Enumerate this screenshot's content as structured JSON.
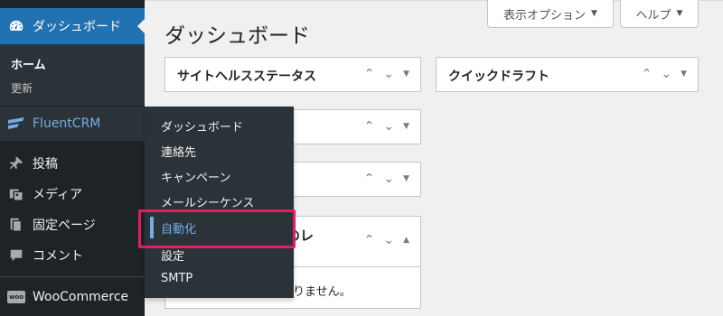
{
  "sidebar": {
    "dashboard_label": "ダッシュボード",
    "home_label": "ホーム",
    "updates_label": "更新",
    "fluentcrm_label": "FluentCRM",
    "posts_label": "投稿",
    "media_label": "メディア",
    "pages_label": "固定ページ",
    "comments_label": "コメント",
    "woocommerce_label": "WooCommerce",
    "woo_icon_text": "woo"
  },
  "flyout": {
    "items": [
      "ダッシュボード",
      "連絡先",
      "キャンペーン",
      "メールシーケンス",
      "自動化",
      "設定",
      "SMTP"
    ],
    "active_index": 4
  },
  "header": {
    "screen_options": "表示オプション",
    "help": "ヘルプ"
  },
  "page_title": "ダッシュボード",
  "widgets": {
    "site_health_title": "サイトヘルスステータス",
    "quick_draft_title": "クイックドラフト",
    "partial_title": "のレ",
    "partial_text": "ありません。"
  },
  "colors": {
    "sidebar_bg": "#1d2327",
    "submenu_bg": "#2c3338",
    "accent": "#2271b1",
    "link_blue": "#72aee6",
    "highlight_border": "#e61c61"
  }
}
